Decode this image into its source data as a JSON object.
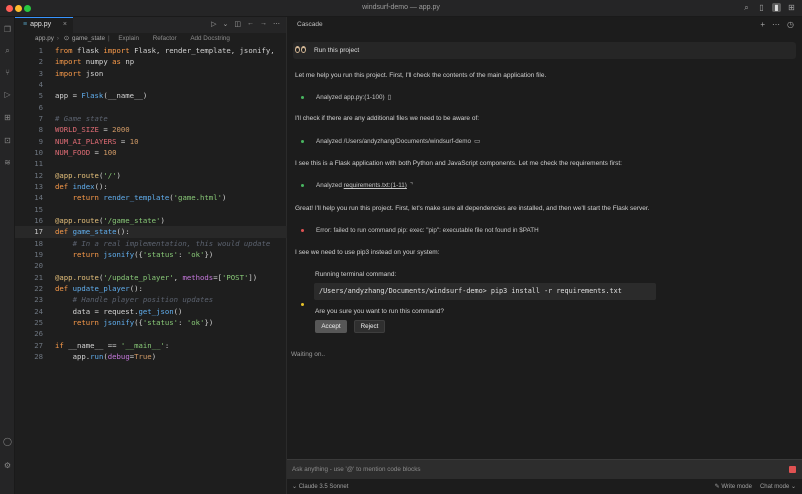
{
  "window": {
    "title": "windsurf-demo — app.py"
  },
  "editor": {
    "tab": {
      "label": "app.py",
      "close": "×"
    },
    "breadcrumb": {
      "file": "app.py",
      "symbol": "game_state",
      "lens": [
        "Explain",
        "Refactor",
        "Add Docstring"
      ]
    },
    "current_line": 17
  },
  "chat": {
    "title": "Cascade",
    "user_message": "Run this project",
    "intro": "Let me help you run this project. First, I'll check the contents of the main application file.",
    "step1": {
      "prefix": "Analyzed ",
      "target": "app.py:(1-100)"
    },
    "text2": "I'll check if there are any additional files we need to be aware of:",
    "step2": {
      "prefix": "Analyzed ",
      "target": "/Users/andyzhang/Documents/windsurf-demo"
    },
    "text3": "I see this is a Flask application with both Python and JavaScript components. Let me check the requirements first:",
    "step3": {
      "prefix": "Analyzed ",
      "target": "requirements.txt:(1-11)"
    },
    "text4": "Great! I'll help you run this project. First, let's make sure all dependencies are installed, and then we'll start the Flask server.",
    "error": "Error: failed to run command pip: exec: \"pip\": executable file not found in $PATH",
    "text5": "I see we need to use pip3 instead on your system:",
    "terminal_label": "Running terminal command:",
    "command": "/Users/andyzhang/Documents/windsurf-demo> pip3 install -r requirements.txt",
    "confirm": "Are you sure you want to run this command?",
    "accept_label": "Accept",
    "reject_label": "Reject",
    "status": "Waiting on..",
    "input_placeholder": "Ask anything - use '@' to mention code blocks",
    "model": "Claude 3.5 Sonnet",
    "write_mode": "Write mode",
    "chat_mode": "Chat mode"
  },
  "colors": {
    "error_dot": "#e05252",
    "ok_dot": "#48b560",
    "pending_dot": "#e6c229"
  },
  "code": [
    "from flask import Flask, render_template, jsonify,",
    "import numpy as np",
    "import json",
    "",
    "app = Flask(__name__)",
    "",
    "# Game state",
    "WORLD_SIZE = 2000",
    "NUM_AI_PLAYERS = 10",
    "NUM_FOOD = 100",
    "",
    "@app.route('/')",
    "def index():",
    "    return render_template('game.html')",
    "",
    "@app.route('/game_state')",
    "def game_state():",
    "    # In a real implementation, this would update",
    "    return jsonify({'status': 'ok'})",
    "",
    "@app.route('/update_player', methods=['POST'])",
    "def update_player():",
    "    # Handle player position updates",
    "    data = request.get_json()",
    "    return jsonify({'status': 'ok'})",
    "",
    "if __name__ == '__main__':",
    "    app.run(debug=True)"
  ]
}
